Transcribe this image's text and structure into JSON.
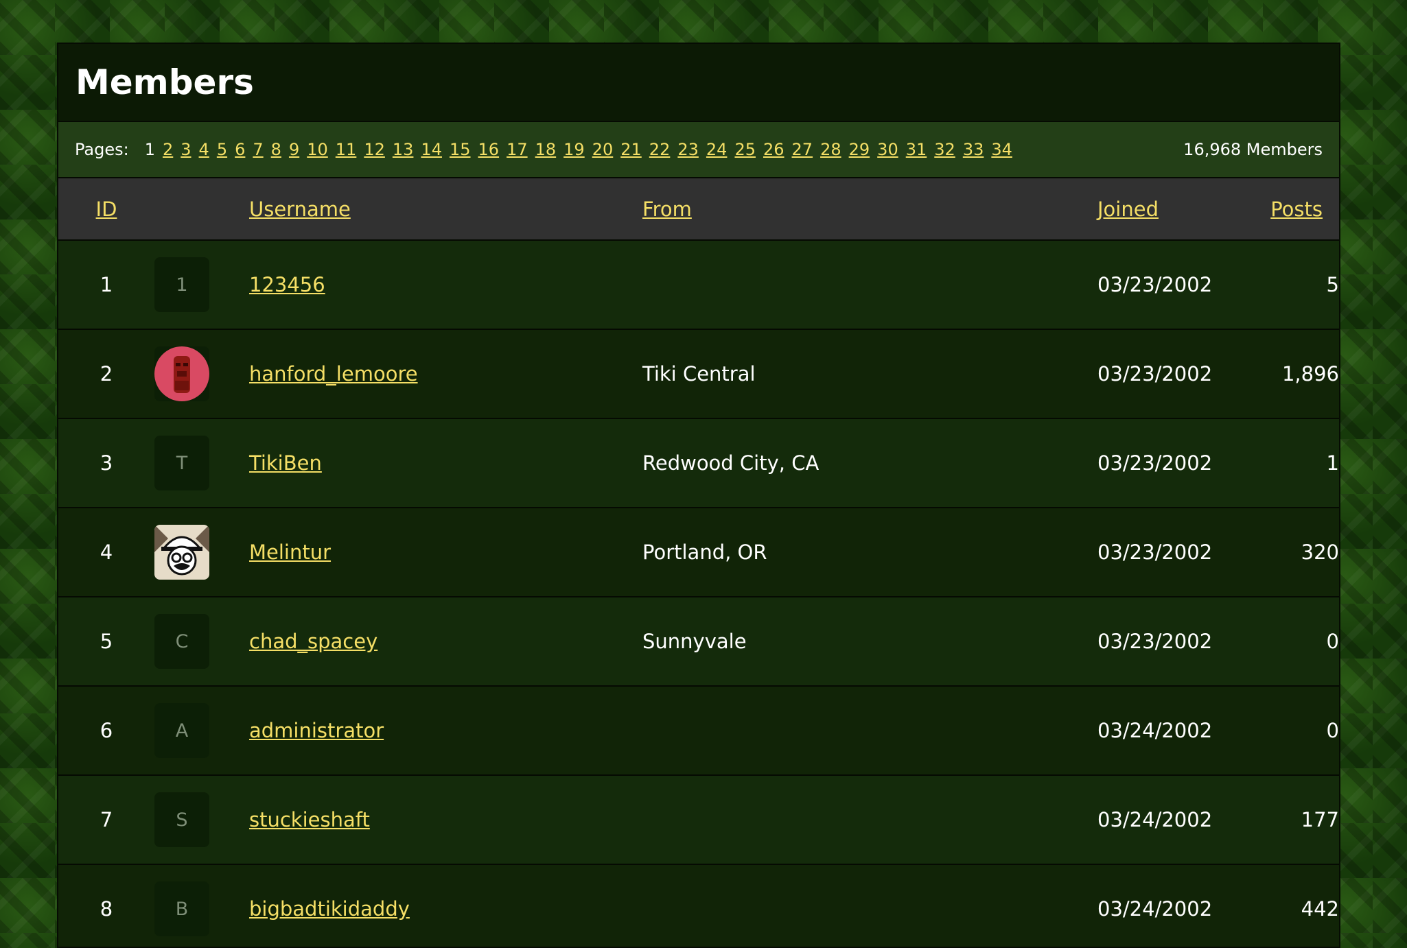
{
  "page": {
    "title": "Members"
  },
  "pagination": {
    "label": "Pages:",
    "current": "1",
    "pages": [
      "2",
      "3",
      "4",
      "5",
      "6",
      "7",
      "8",
      "9",
      "10",
      "11",
      "12",
      "13",
      "14",
      "15",
      "16",
      "17",
      "18",
      "19",
      "20",
      "21",
      "22",
      "23",
      "24",
      "25",
      "26",
      "27",
      "28",
      "29",
      "30",
      "31",
      "32",
      "33",
      "34"
    ],
    "member_count": "16,968 Members"
  },
  "table": {
    "headers": {
      "id": "ID",
      "username": "Username",
      "from": "From",
      "joined": "Joined",
      "posts": "Posts"
    },
    "rows": [
      {
        "id": "1",
        "avatar_letter": "1",
        "avatar_type": "letter",
        "username": "123456",
        "from": "",
        "joined": "03/23/2002",
        "posts": "5"
      },
      {
        "id": "2",
        "avatar_letter": "",
        "avatar_type": "tiki-statue-photo",
        "username": "hanford_lemoore",
        "from": "Tiki Central",
        "joined": "03/23/2002",
        "posts": "1,896"
      },
      {
        "id": "3",
        "avatar_letter": "T",
        "avatar_type": "letter",
        "username": "TikiBen",
        "from": "Redwood City, CA",
        "joined": "03/23/2002",
        "posts": "1"
      },
      {
        "id": "4",
        "avatar_letter": "",
        "avatar_type": "pith-helmet-face-image",
        "username": "Melintur",
        "from": "Portland, OR",
        "joined": "03/23/2002",
        "posts": "320"
      },
      {
        "id": "5",
        "avatar_letter": "C",
        "avatar_type": "letter",
        "username": "chad_spacey",
        "from": "Sunnyvale",
        "joined": "03/23/2002",
        "posts": "0"
      },
      {
        "id": "6",
        "avatar_letter": "A",
        "avatar_type": "letter",
        "username": "administrator",
        "from": "",
        "joined": "03/24/2002",
        "posts": "0"
      },
      {
        "id": "7",
        "avatar_letter": "S",
        "avatar_type": "letter",
        "username": "stuckieshaft",
        "from": "",
        "joined": "03/24/2002",
        "posts": "177"
      },
      {
        "id": "8",
        "avatar_letter": "B",
        "avatar_type": "letter",
        "username": "bigbadtikidaddy",
        "from": "",
        "joined": "03/24/2002",
        "posts": "442"
      }
    ]
  },
  "colors": {
    "link": "#f5df66",
    "text": "#ffffff",
    "header_bg": "#0c1a05",
    "pager_bg": "#233f17",
    "column_header_bg": "#313131",
    "row_bg": "#142b0b"
  }
}
